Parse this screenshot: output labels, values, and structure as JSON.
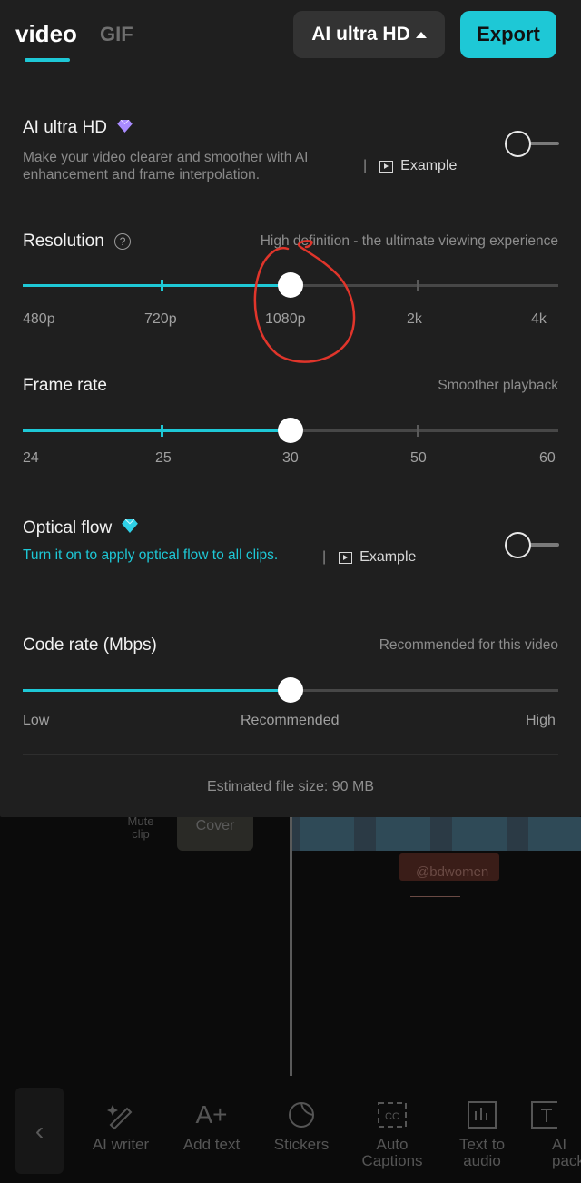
{
  "header": {
    "tabs": [
      {
        "label": "video",
        "active": true
      },
      {
        "label": "GIF",
        "active": false
      }
    ],
    "quality_button": "AI ultra HD",
    "export_button": "Export"
  },
  "ai_ultra_hd": {
    "title": "AI ultra HD",
    "description_line1": "Make your video clearer and smoother with AI",
    "description_line2": "enhancement and frame interpolation.",
    "separator": "|",
    "example_label": "Example",
    "enabled": false
  },
  "resolution": {
    "title": "Resolution",
    "hint": "High definition - the ultimate viewing experience",
    "options": [
      "480p",
      "720p",
      "1080p",
      "2k",
      "4k"
    ],
    "selected": "1080p"
  },
  "frame_rate": {
    "title": "Frame rate",
    "hint": "Smoother playback",
    "options": [
      "24",
      "25",
      "30",
      "50",
      "60"
    ],
    "selected": "30"
  },
  "optical_flow": {
    "title": "Optical flow",
    "description": "Turn it on to apply optical flow to all clips.",
    "separator": "|",
    "example_label": "Example",
    "enabled": false
  },
  "code_rate": {
    "title": "Code rate (Mbps)",
    "hint": "Recommended for this video",
    "labels": [
      "Low",
      "Recommended",
      "High"
    ],
    "level": 0.5
  },
  "estimated_size": "Estimated file size: 90 MB",
  "editor": {
    "mute_label": "Mute clip",
    "cover_label": "Cover",
    "sticker_text": "@bdwomen"
  },
  "toolbar": [
    {
      "label": "AI writer",
      "icon": "ai-writer-icon"
    },
    {
      "label": "Add text",
      "icon": "add-text-icon"
    },
    {
      "label": "Stickers",
      "icon": "stickers-icon"
    },
    {
      "label": "Auto Captions",
      "icon": "captions-icon"
    },
    {
      "label": "Text to audio",
      "icon": "text-to-audio-icon"
    },
    {
      "label": "AI packa",
      "icon": "ai-package-icon"
    }
  ],
  "colors": {
    "accent": "#1ec8d6",
    "panel": "#1f1f1f",
    "annotation": "#e0352b"
  }
}
